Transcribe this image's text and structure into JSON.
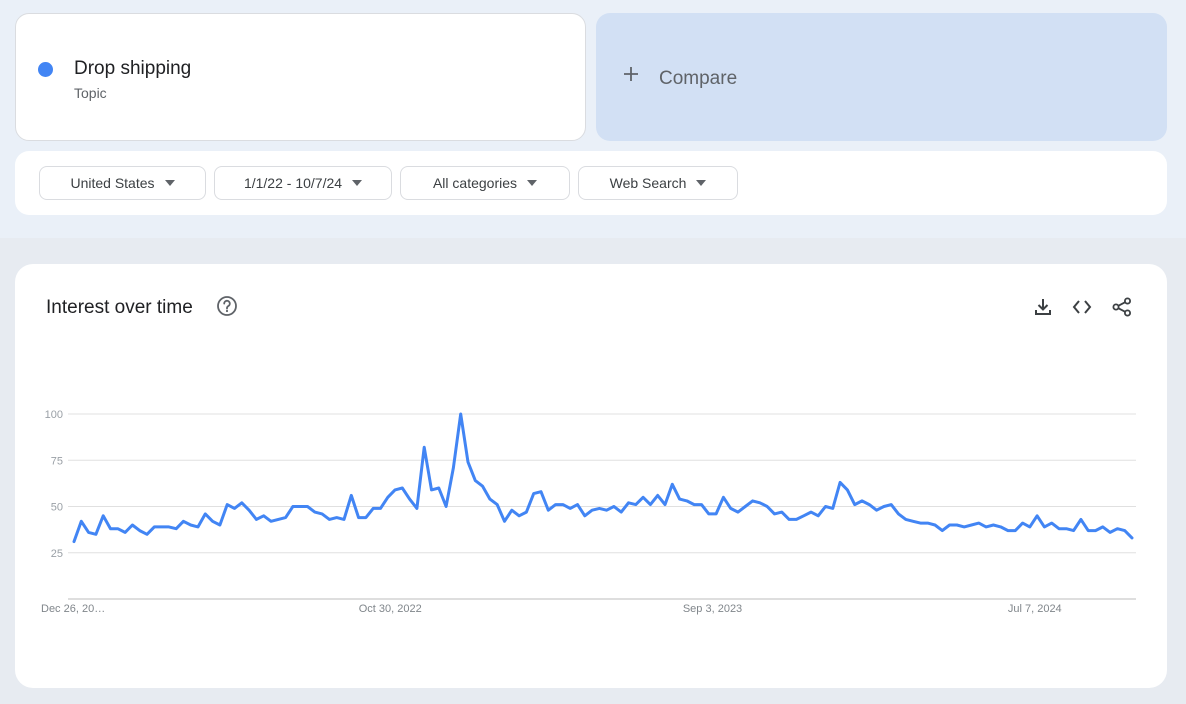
{
  "search_term": {
    "name": "Drop shipping",
    "type": "Topic",
    "color": "#4285f4"
  },
  "compare": {
    "label": "Compare"
  },
  "filters": {
    "region": "United States",
    "date_range": "1/1/22 - 10/7/24",
    "category": "All categories",
    "property": "Web Search"
  },
  "chart_section": {
    "title": "Interest over time"
  },
  "icons": [
    "help-icon",
    "download-icon",
    "embed-code-icon",
    "share-icon",
    "plus-icon",
    "caret-down-icon"
  ],
  "chart_data": {
    "type": "line",
    "title": "Interest over time",
    "ylim": [
      0,
      100
    ],
    "y_ticks": [
      25,
      50,
      75,
      100
    ],
    "x_tick_labels": [
      "Dec 26, 20…",
      "Oct 30, 2022",
      "Sep 3, 2023",
      "Jul 7, 2024"
    ],
    "x_tick_dates": [
      "2021-12-26",
      "2022-10-30",
      "2023-09-03",
      "2024-07-07"
    ],
    "x_range": [
      "2021-12-26",
      "2024-10-06"
    ],
    "grid": true,
    "series": [
      {
        "name": "Drop shipping",
        "color": "#4285f4",
        "values": [
          31,
          42,
          36,
          35,
          45,
          38,
          38,
          36,
          40,
          37,
          35,
          39,
          39,
          39,
          38,
          42,
          40,
          39,
          46,
          42,
          40,
          51,
          49,
          52,
          48,
          43,
          45,
          42,
          43,
          44,
          50,
          50,
          50,
          47,
          46,
          43,
          44,
          43,
          56,
          44,
          44,
          49,
          49,
          55,
          59,
          60,
          54,
          49,
          82,
          59,
          60,
          50,
          71,
          100,
          74,
          64,
          61,
          54,
          51,
          42,
          48,
          45,
          47,
          57,
          58,
          48,
          51,
          51,
          49,
          51,
          45,
          48,
          49,
          48,
          50,
          47,
          52,
          51,
          55,
          51,
          56,
          51,
          62,
          54,
          53,
          51,
          51,
          46,
          46,
          55,
          49,
          47,
          50,
          53,
          52,
          50,
          46,
          47,
          43,
          43,
          45,
          47,
          45,
          50,
          49,
          63,
          59,
          51,
          53,
          51,
          48,
          50,
          51,
          46,
          43,
          42,
          41,
          41,
          40,
          37,
          40,
          40,
          39,
          40,
          41,
          39,
          40,
          39,
          37,
          37,
          41,
          39,
          45,
          39,
          41,
          38,
          38,
          37,
          43,
          37,
          37,
          39,
          36,
          38,
          37,
          33
        ]
      }
    ]
  }
}
